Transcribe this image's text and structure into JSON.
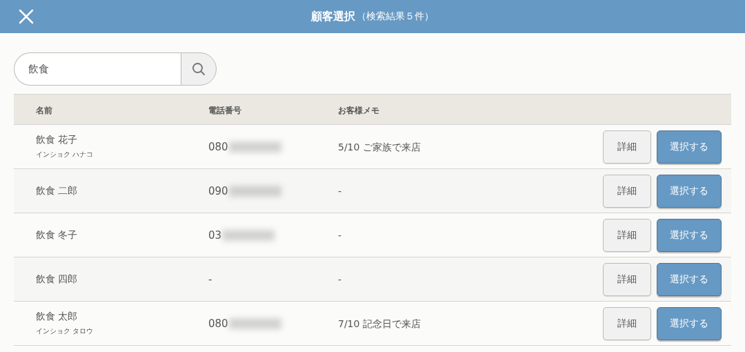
{
  "header": {
    "title": "顧客選択",
    "subtitle": "（検索結果５件）"
  },
  "search": {
    "value": "飲食"
  },
  "table": {
    "columns": [
      "名前",
      "電話番号",
      "お客様メモ"
    ],
    "rows": [
      {
        "name": "飲食 花子",
        "kana": "インショク ハナコ",
        "phone": "080",
        "phone_redacted": true,
        "memo": "5/10 ご家族で来店",
        "detail": "詳細",
        "select": "選択する"
      },
      {
        "name": "飲食 二郎",
        "phone": "090",
        "phone_redacted": true,
        "memo": "-",
        "detail": "詳細",
        "select": "選択する"
      },
      {
        "name": "飲食 冬子",
        "phone": "03",
        "phone_redacted": true,
        "memo": "-",
        "detail": "詳細",
        "select": "選択する"
      },
      {
        "name": "飲食 四郎",
        "phone": "-",
        "phone_redacted": false,
        "memo": "-",
        "detail": "詳細",
        "select": "選択する"
      },
      {
        "name": "飲食 太郎",
        "kana": "インショク タロウ",
        "phone": "080",
        "phone_redacted": true,
        "memo": "7/10 記念日で来店",
        "detail": "詳細",
        "select": "選択する"
      }
    ]
  }
}
